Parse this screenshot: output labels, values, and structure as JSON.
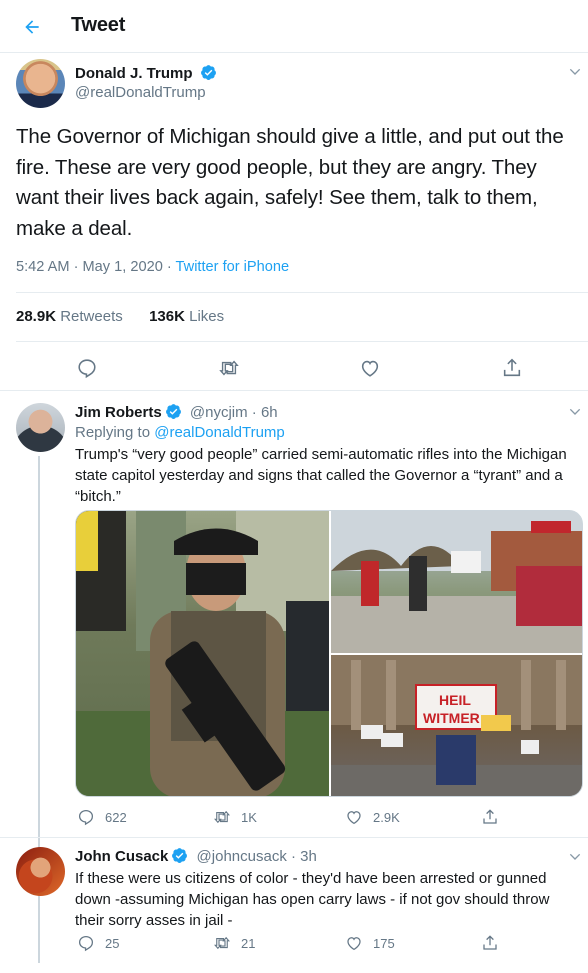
{
  "header": {
    "title": "Tweet"
  },
  "main_tweet": {
    "name": "Donald J. Trump",
    "handle": "@realDonaldTrump",
    "text": "The Governor of Michigan should give a little, and put out the fire. These are very good people, but they are angry. They want their lives back again, safely! See them, talk to them, make a deal.",
    "time": "5:42 AM · May 1, 2020 · ",
    "source": "Twitter for iPhone",
    "retweets_count": "28.9K",
    "retweets_label": "Retweets",
    "likes_count": "136K",
    "likes_label": "Likes"
  },
  "replies": [
    {
      "name": "Jim Roberts",
      "handle": "@nycjim",
      "age": "· 6h",
      "replying_prefix": "Replying to ",
      "replying_to": "@realDonaldTrump",
      "text": "Trump's “very good people” carried semi-automatic rifles into the Michigan state capitol yesterday and signs that called the Governor a “tyrant” and a “bitch.”",
      "sign_text_1": "HEIL",
      "sign_text_2": "WITMER",
      "replies_count": "622",
      "retweets_count": "1K",
      "likes_count": "2.9K"
    },
    {
      "name": "John Cusack",
      "handle": "@johncusack",
      "age": "· 3h",
      "text": "If these were us citizens of color - they'd have been arrested or gunned down -assuming Michigan has open carry laws -  if not gov should throw their sorry asses in jail -",
      "replies_count": "25",
      "retweets_count": "21",
      "likes_count": "175"
    }
  ],
  "colors": {
    "accent": "#1da1f2",
    "text": "#14171a",
    "muted": "#657786",
    "border": "#e6ecf0"
  }
}
